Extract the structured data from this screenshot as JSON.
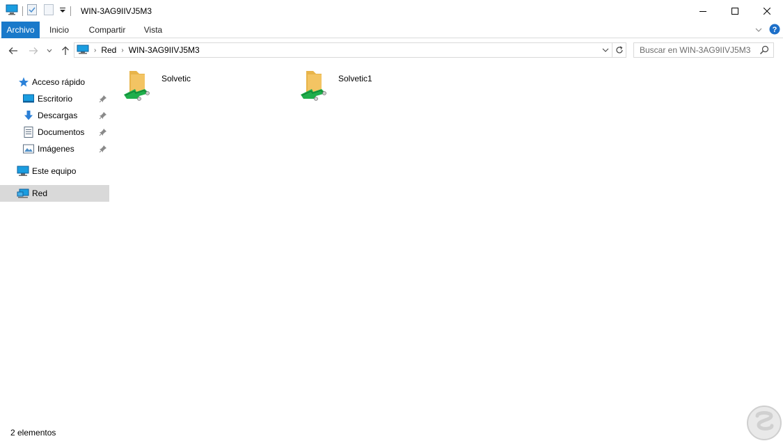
{
  "window": {
    "title": "WIN-3AG9IIVJ5M3"
  },
  "ribbon": {
    "tabs": [
      "Archivo",
      "Inicio",
      "Compartir",
      "Vista"
    ]
  },
  "address": {
    "crumbs": [
      "Red",
      "WIN-3AG9IIVJ5M3"
    ]
  },
  "search": {
    "placeholder": "Buscar en WIN-3AG9IIVJ5M3"
  },
  "navpane": {
    "quick_access": "Acceso rápido",
    "pinned": [
      "Escritorio",
      "Descargas",
      "Documentos",
      "Imágenes"
    ],
    "this_pc": "Este equipo",
    "network": "Red"
  },
  "content": {
    "items": [
      {
        "name": "Solvetic",
        "icon": "shared-folder-icon"
      },
      {
        "name": "Solvetic1",
        "icon": "shared-folder-icon"
      }
    ]
  },
  "statusbar": {
    "count": "2 elementos"
  },
  "colors": {
    "accent": "#1979ca",
    "selected": "#d9d9d9",
    "folder": "#f3c463",
    "share_arrow": "#1fae4b"
  }
}
